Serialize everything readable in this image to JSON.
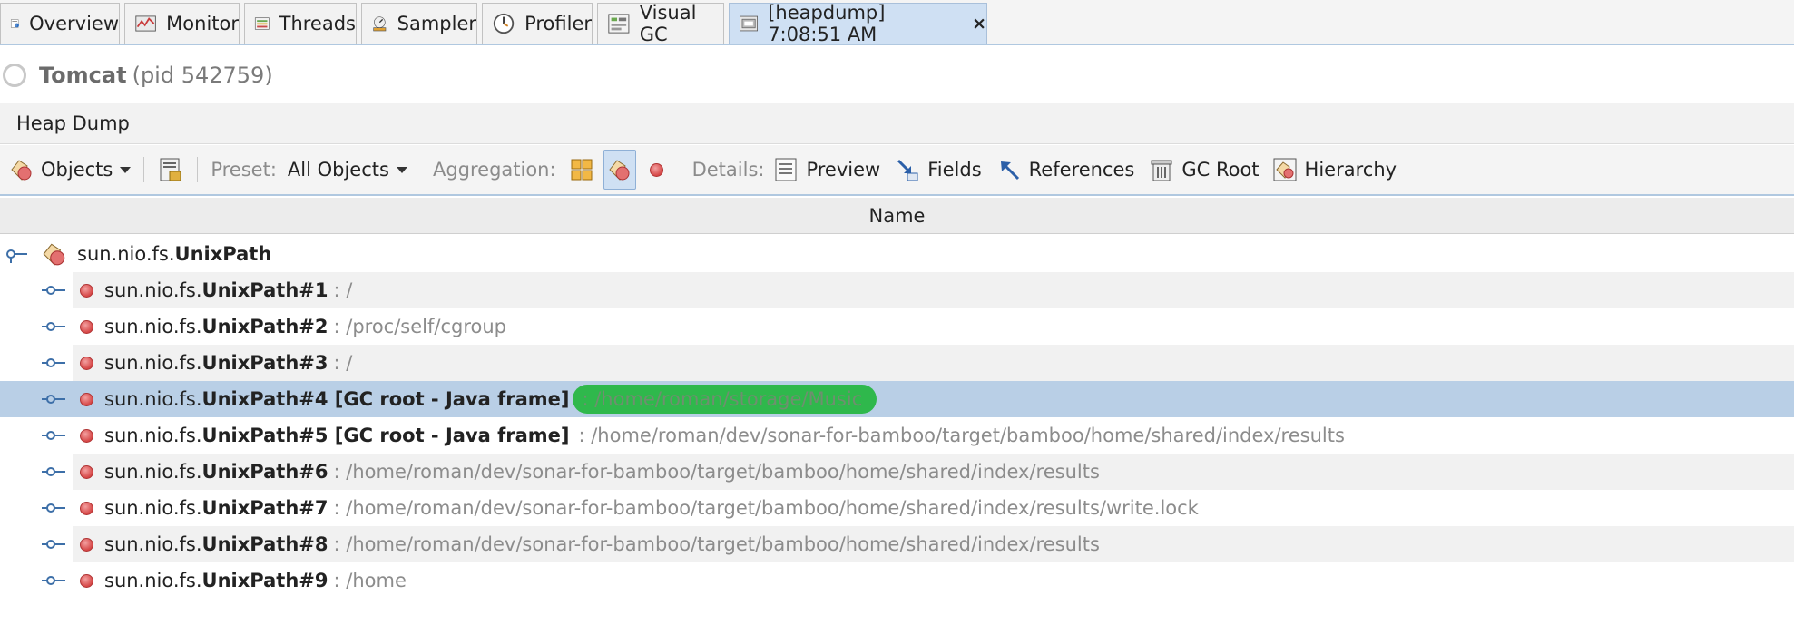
{
  "tabs": [
    {
      "label": "Overview",
      "icon": "overview-icon"
    },
    {
      "label": "Monitor",
      "icon": "monitor-icon"
    },
    {
      "label": "Threads",
      "icon": "threads-icon"
    },
    {
      "label": "Sampler",
      "icon": "sampler-icon"
    },
    {
      "label": "Profiler",
      "icon": "profiler-icon"
    },
    {
      "label": "Visual GC",
      "icon": "visual-gc-icon"
    },
    {
      "label": "[heapdump] 7:08:51 AM",
      "icon": "heapdump-icon",
      "close": "×"
    }
  ],
  "app": {
    "name": "Tomcat",
    "pid": "(pid 542759)"
  },
  "section_title": "Heap Dump",
  "toolbar": {
    "objects_label": "Objects",
    "preset_label": "Preset:",
    "preset_value": "All Objects",
    "aggregation_label": "Aggregation:",
    "details_label": "Details:",
    "preview_label": "Preview",
    "fields_label": "Fields",
    "references_label": "References",
    "gcroot_label": "GC Root",
    "hierarchy_label": "Hierarchy"
  },
  "table": {
    "column_name": "Name",
    "root": {
      "prefix": "sun.nio.fs.",
      "name": "UnixPath"
    },
    "rows": [
      {
        "prefix": "sun.nio.fs.",
        "name": "UnixPath#1",
        "value": ": /"
      },
      {
        "prefix": "sun.nio.fs.",
        "name": "UnixPath#2",
        "value": ": /proc/self/cgroup"
      },
      {
        "prefix": "sun.nio.fs.",
        "name": "UnixPath#3",
        "value": ": /"
      },
      {
        "prefix": "sun.nio.fs.",
        "name": "UnixPath#4 [GC root - Java frame]",
        "value": ": /home/roman/storage/Music"
      },
      {
        "prefix": "sun.nio.fs.",
        "name": "UnixPath#5 [GC root - Java frame]",
        "value": ": /home/roman/dev/sonar-for-bamboo/target/bamboo/home/shared/index/results"
      },
      {
        "prefix": "sun.nio.fs.",
        "name": "UnixPath#6",
        "value": ": /home/roman/dev/sonar-for-bamboo/target/bamboo/home/shared/index/results"
      },
      {
        "prefix": "sun.nio.fs.",
        "name": "UnixPath#7",
        "value": ": /home/roman/dev/sonar-for-bamboo/target/bamboo/home/shared/index/results/write.lock"
      },
      {
        "prefix": "sun.nio.fs.",
        "name": "UnixPath#8",
        "value": ": /home/roman/dev/sonar-for-bamboo/target/bamboo/home/shared/index/results"
      },
      {
        "prefix": "sun.nio.fs.",
        "name": "UnixPath#9",
        "value": ": /home"
      }
    ]
  },
  "colors": {
    "selection": "#b9cfe6",
    "highlight": "#2fb84c",
    "instance_dot": "#d64747"
  }
}
